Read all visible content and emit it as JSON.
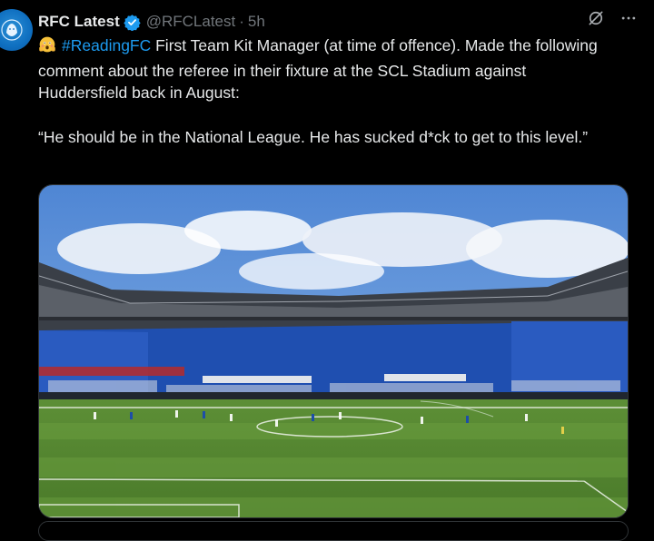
{
  "tweet": {
    "author_name": "RFC Latest",
    "handle": "@RFCLatest",
    "separator": "·",
    "time": "5h",
    "hashtag": "#ReadingFC",
    "text_after_hashtag": " First Team Kit Manager (at time of offence). Made the following comment about the referee in their fixture at the SCL Stadium against Huddersfield back in August:",
    "quote": "“He should be in the National League. He has sucked d*ck to get to this level.”",
    "emoji": "flushed-face-with-hands",
    "image_alt": "Stadium photo"
  },
  "icons": {
    "avatar": "lion-crest-icon",
    "verified": "verified-badge-icon",
    "grok": "grok-icon",
    "more": "more-icon"
  },
  "colors": {
    "background": "#000000",
    "text": "#e7e9ea",
    "secondary": "#71767b",
    "accent": "#1d9bf0"
  }
}
